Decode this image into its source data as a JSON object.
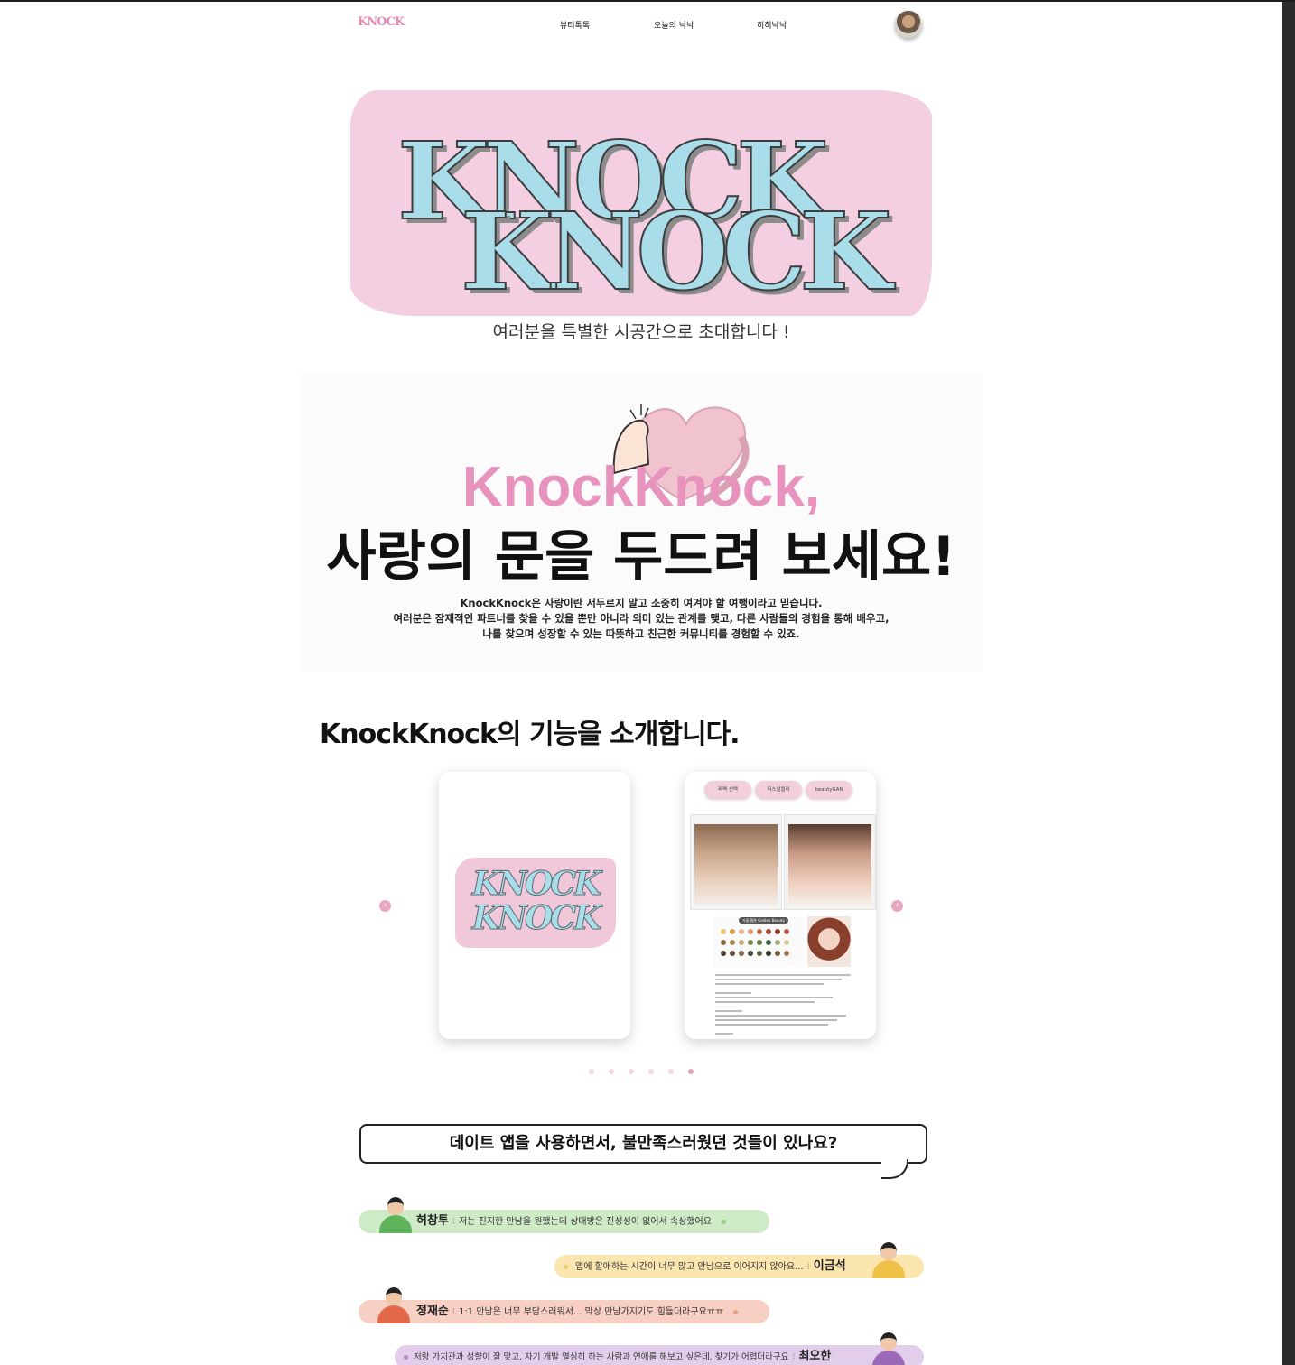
{
  "nav": {
    "logo": "KNOCK",
    "items": [
      "뷰티톡톡",
      "오늘의 낙낙",
      "히히낙낙"
    ]
  },
  "hero": {
    "title_line1": "KNOCK",
    "title_line2": "KNOCK",
    "subtitle": "여러분을 특별한 시공간으로 초대합니다 !"
  },
  "intro": {
    "title": "KnockKnock,",
    "heading": "사랑의 문을 두드려 보세요!",
    "desc": [
      "KnockKnock은 사랑이란 서두르지 말고 소중히 여겨야 할 여행이라고 믿습니다.",
      "여러분은 잠재적인 파트너를 찾을 수 있을 뿐만 아니라 의미 있는 관계를 맺고, 다른 사람들의 경험을 통해 배우고,",
      "나를 찾으며 성장할 수 있는 따뜻하고 친근한 커뮤니티를 경험할 수 있죠."
    ]
  },
  "features": {
    "title": "KnockKnock의 기능을 소개합니다.",
    "card1_logo": [
      "KNOCK",
      "KNOCK"
    ],
    "card2_tabs": [
      "퍼펙 선택",
      "퍼스널컬러",
      "beautyGAN"
    ],
    "card2_palette_label": "가을 웜톤 Golden Beauty",
    "dots_count": 6,
    "active_dot": 5
  },
  "complaints": {
    "question": "데이트 앱을 사용하면서, 불만족스러웠던 것들이 있나요?",
    "items": [
      {
        "name": "허창투",
        "text": "저는 진지한 만남을 원했는데 상대방은 진성성이 없어서 속상했어요",
        "color": "#cfeac6",
        "side": "left"
      },
      {
        "name": "이금석",
        "text": "앱에 할애하는 시간이 너무 많고 만남으로 이어지지 않아요...",
        "color": "#fbe6b0",
        "side": "right"
      },
      {
        "name": "정재순",
        "text": "1:1 만남은 너무 부담스러워서... 막상 만남가지기도 힘들더라구요ㅠㅠ",
        "color": "#f8cfc3",
        "side": "left"
      },
      {
        "name": "최오한",
        "text": "저랑 가치관과 성향이 잘 맞고, 자기 개발 열심히 하는 사람과 연애를 해보고 싶은데, 찾기가 어렵더라구요",
        "color": "#e2cdea",
        "side": "right"
      }
    ]
  },
  "colors": {
    "brand_pink": "#e893bd",
    "hero_bg": "#f3cfe1",
    "hero_text": "#a9dde9"
  }
}
